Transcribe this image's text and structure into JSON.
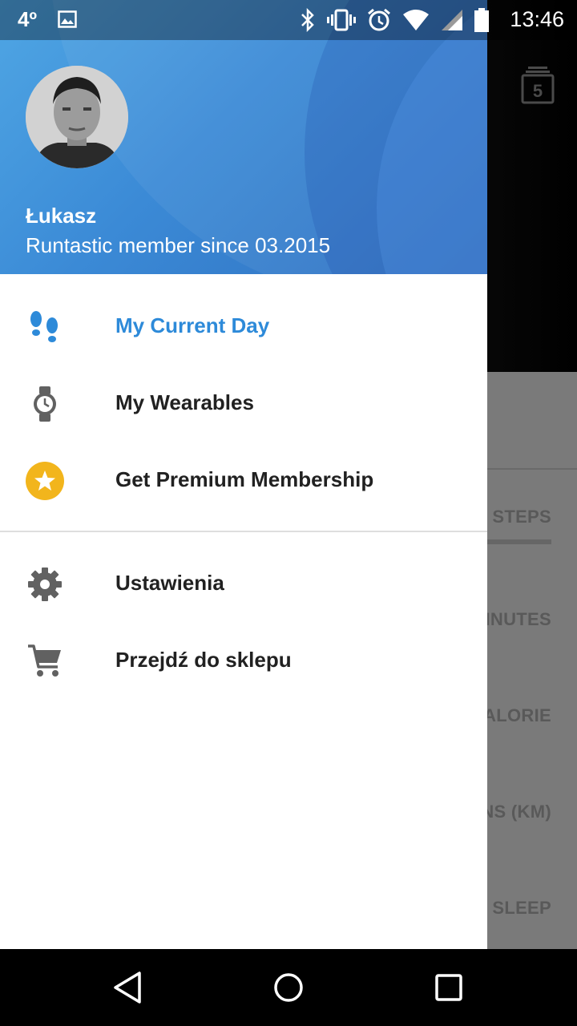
{
  "status_bar": {
    "temperature": "4º",
    "time": "13:46"
  },
  "drawer": {
    "user": {
      "name": "Łukasz",
      "subtitle": "Runtastic member since 03.2015"
    },
    "items": [
      {
        "label": "My Current Day",
        "icon": "footsteps-icon",
        "active": true
      },
      {
        "label": "My Wearables",
        "icon": "watch-icon",
        "active": false
      },
      {
        "label": "Get Premium Membership",
        "icon": "premium-star-icon",
        "active": false
      },
      {
        "label": "Ustawienia",
        "icon": "gear-icon",
        "active": false
      },
      {
        "label": "Przejdź do sklepu",
        "icon": "cart-icon",
        "active": false
      }
    ]
  },
  "background_app": {
    "calendar_day": "5",
    "labels": [
      "STEPS",
      "INUTES",
      "ALORIE",
      "NS (KM)",
      "SLEEP"
    ]
  },
  "colors": {
    "accent": "#2d8ad9",
    "premium": "#f2b51c",
    "icon_gray": "#616161"
  }
}
